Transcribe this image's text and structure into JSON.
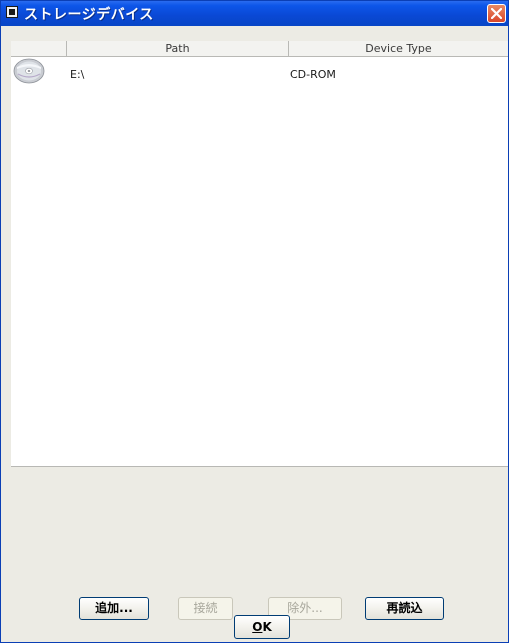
{
  "window": {
    "title": "ストレージデバイス"
  },
  "table": {
    "columns": [
      "",
      "Path",
      "Device Type"
    ],
    "rows": [
      {
        "icon": "cd-rom-icon",
        "path": "E:\\",
        "device_type": "CD-ROM"
      }
    ]
  },
  "buttons": {
    "add": "追加...",
    "connect": "接続",
    "remove": "除外...",
    "reload": "再読込",
    "ok_mnemonic": "O",
    "ok_rest": "K"
  },
  "colors": {
    "titlebar": "#0a48d4",
    "close": "#d9462a",
    "button_border": "#003c74",
    "disabled_text": "#a7a69b"
  }
}
